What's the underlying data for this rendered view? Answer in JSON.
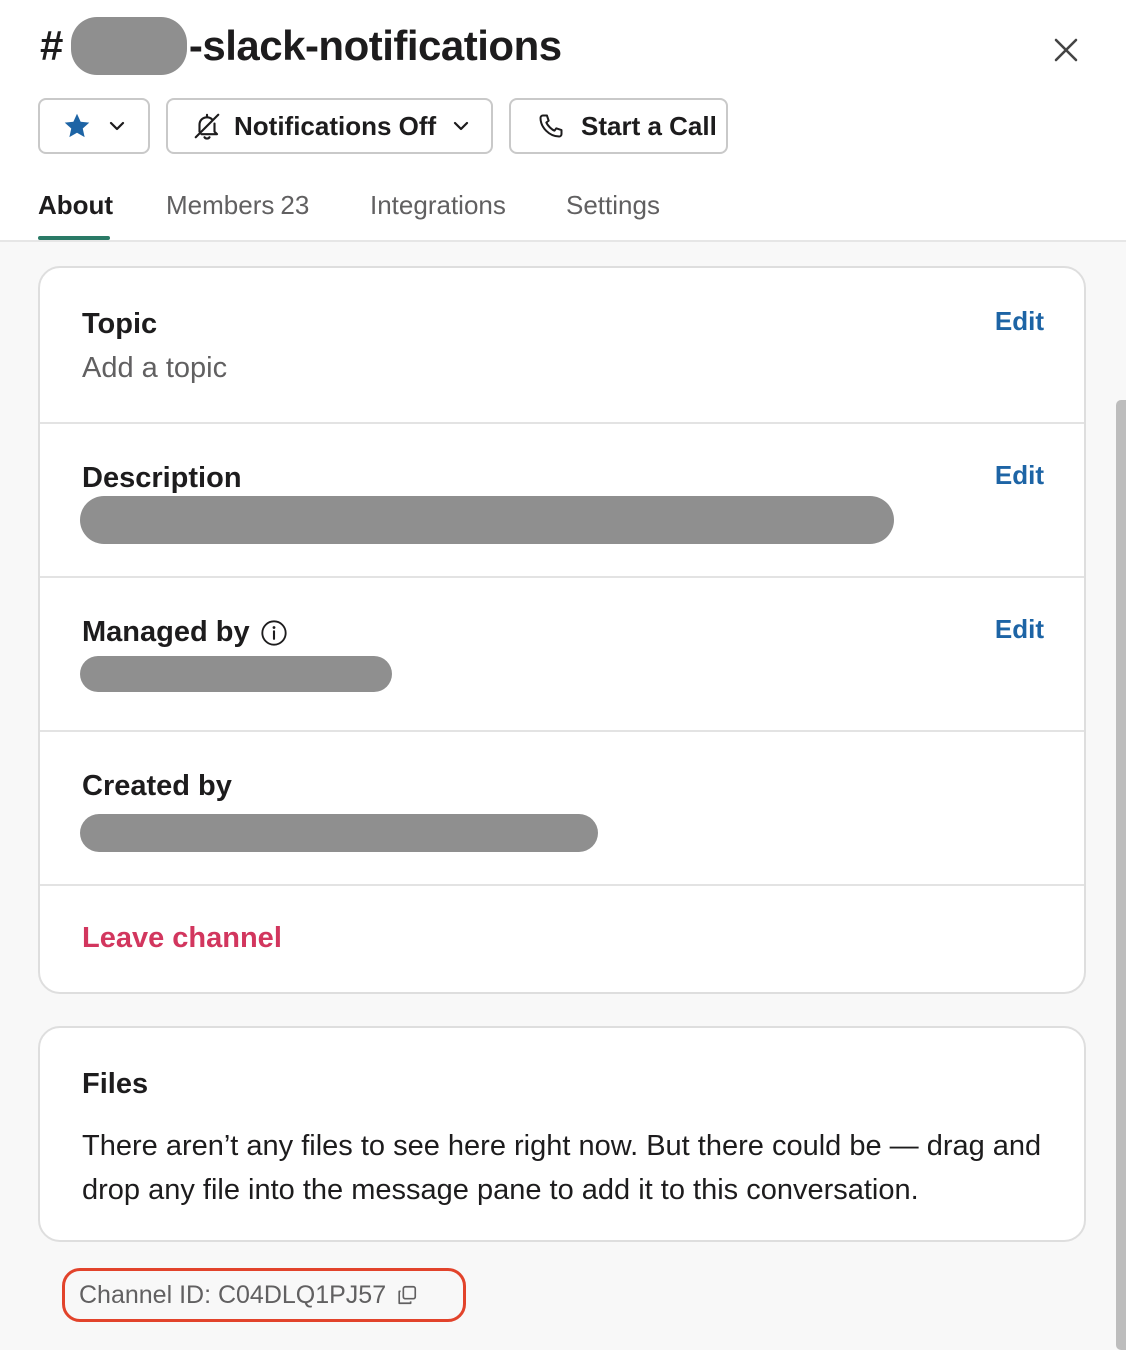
{
  "header": {
    "channel_prefix": "#",
    "channel_suffix": "-slack-notifications",
    "close_label": "×"
  },
  "toolbar": {
    "notifications_label": "Notifications Off",
    "call_label": "Start a Call"
  },
  "tabs": [
    {
      "label": "About",
      "active": true
    },
    {
      "label": "Members",
      "count": "23"
    },
    {
      "label": "Integrations"
    },
    {
      "label": "Settings"
    }
  ],
  "about": {
    "topic_label": "Topic",
    "topic_placeholder": "Add a topic",
    "description_label": "Description",
    "managed_label": "Managed by",
    "created_label": "Created by",
    "edit_label": "Edit",
    "leave_label": "Leave channel"
  },
  "files": {
    "title": "Files",
    "text": "There aren’t any files to see here right now. But there could be — drag and drop any file into the message pane to add it to this conversation."
  },
  "channel_id": {
    "text": "Channel ID: C04DLQ1PJ57"
  },
  "colors": {
    "accent_tab": "#2a7a66",
    "link": "#1d64a5",
    "danger": "#d2365e",
    "highlight_box": "#e2432b",
    "star": "#1d64a5"
  }
}
